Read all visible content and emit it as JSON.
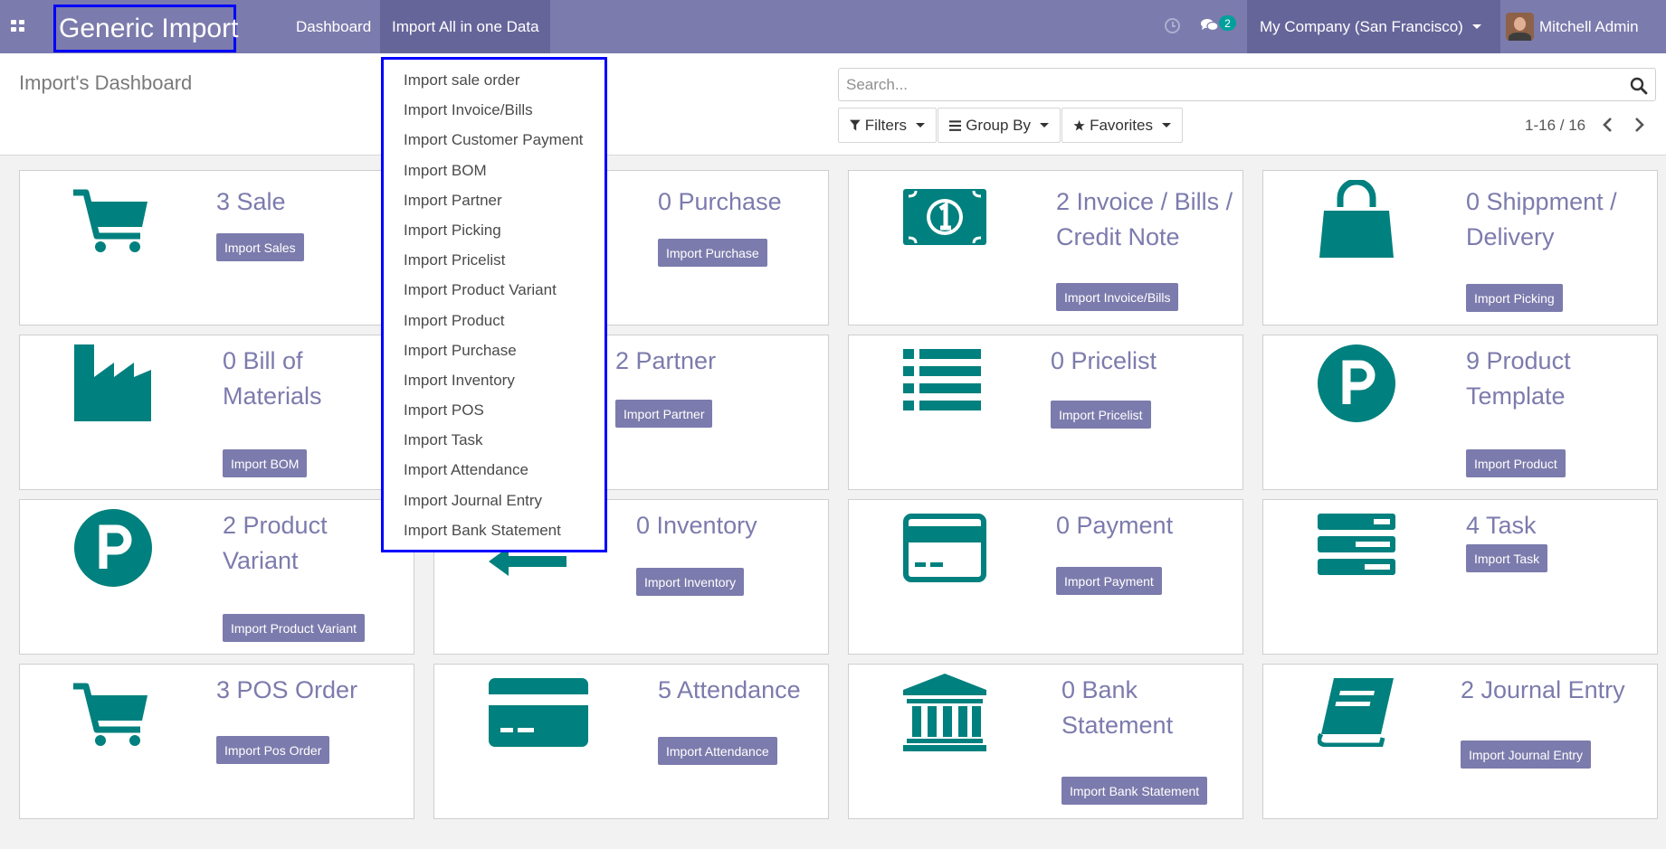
{
  "navbar": {
    "brand": "Generic Import",
    "menu": [
      "Dashboard",
      "Import All in one Data"
    ],
    "chat_count": "2",
    "company": "My Company (San Francisco)",
    "user": "Mitchell Admin"
  },
  "control_panel": {
    "title": "Import's Dashboard",
    "search_placeholder": "Search...",
    "filters": [
      "Filters",
      "Group By",
      "Favorites"
    ],
    "pager": "1-16 / 16"
  },
  "dropdown": {
    "items": [
      "Import sale order",
      "Import Invoice/Bills",
      "Import Customer Payment",
      "Import BOM",
      "Import Partner",
      "Import Picking",
      "Import Pricelist",
      "Import Product Variant",
      "Import Product",
      "Import Purchase",
      "Import Inventory",
      "Import POS",
      "Import Task",
      "Import Attendance",
      "Import Journal Entry",
      "Import Bank Statement"
    ]
  },
  "cards": [
    {
      "title": "3 Sale",
      "button": "Import Sales",
      "icon": "cart-icon"
    },
    {
      "title": "0 Purchase",
      "button": "Import Purchase",
      "icon": "purchase-icon"
    },
    {
      "title": "2 Invoice / Bills / Credit Note",
      "button": "Import Invoice/Bills",
      "icon": "money-icon"
    },
    {
      "title": "0 Shippment / Delivery",
      "button": "Import Picking",
      "icon": "shopping-bag-icon"
    },
    {
      "title": "0 Bill of Materials",
      "button": "Import BOM",
      "icon": "industry-icon"
    },
    {
      "title": "2 Partner",
      "button": "Import Partner",
      "icon": "partner-icon"
    },
    {
      "title": "0 Pricelist",
      "button": "Import Pricelist",
      "icon": "list-icon"
    },
    {
      "title": "9 Product Template",
      "button": "Import Product",
      "icon": "product-p-icon"
    },
    {
      "title": "2 Product Variant",
      "button": "Import Product Variant",
      "icon": "product-variant-p-icon"
    },
    {
      "title": "0 Inventory",
      "button": "Import Inventory",
      "icon": "arrow-left-icon"
    },
    {
      "title": "0 Payment",
      "button": "Import Payment",
      "icon": "payment-card-icon"
    },
    {
      "title": "4 Task",
      "button": "Import Task",
      "icon": "tasks-icon"
    },
    {
      "title": "3 POS Order",
      "button": "Import Pos Order",
      "icon": "pos-cart-icon"
    },
    {
      "title": "5 Attendance",
      "button": "Import Attendance",
      "icon": "credit-card-icon"
    },
    {
      "title": "0 Bank Statement",
      "button": "Import Bank Statement",
      "icon": "bank-icon"
    },
    {
      "title": "2 Journal Entry",
      "button": "Import Journal Entry",
      "icon": "book-icon"
    }
  ],
  "colors": {
    "navbar": "#7c7bad",
    "navbar_active": "#66659a",
    "icon_teal": "#00807e",
    "button": "#7c7bad",
    "highlight_border": "#0000ff"
  }
}
